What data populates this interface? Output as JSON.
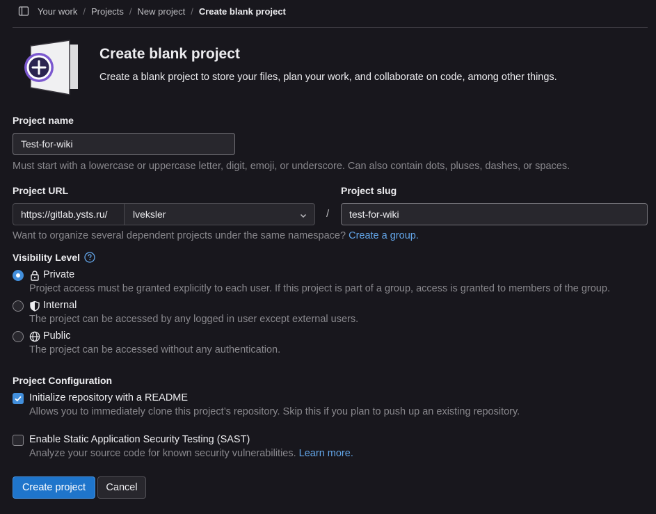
{
  "breadcrumb": {
    "items": [
      "Your work",
      "Projects",
      "New project"
    ],
    "current": "Create blank project",
    "separator": "/"
  },
  "header": {
    "title": "Create blank project",
    "description": "Create a blank project to store your files, plan your work, and collaborate on code, among other things."
  },
  "project_name": {
    "label": "Project name",
    "value": "Test-for-wiki",
    "help": "Must start with a lowercase or uppercase letter, digit, emoji, or underscore. Can also contain dots, pluses, dashes, or spaces."
  },
  "project_url": {
    "label": "Project URL",
    "prefix": "https://gitlab.ysts.ru/",
    "namespace": "lveksler",
    "separator": "/",
    "help": "Want to organize several dependent projects under the same namespace?",
    "help_link": "Create a group."
  },
  "project_slug": {
    "label": "Project slug",
    "value": "test-for-wiki"
  },
  "visibility": {
    "label": "Visibility Level",
    "options": [
      {
        "label": "Private",
        "icon": "lock-icon",
        "selected": true,
        "help": "Project access must be granted explicitly to each user. If this project is part of a group, access is granted to members of the group."
      },
      {
        "label": "Internal",
        "icon": "shield-icon",
        "selected": false,
        "help": "The project can be accessed by any logged in user except external users."
      },
      {
        "label": "Public",
        "icon": "earth-icon",
        "selected": false,
        "help": "The project can be accessed without any authentication."
      }
    ]
  },
  "configuration": {
    "label": "Project Configuration",
    "readme": {
      "label": "Initialize repository with a README",
      "checked": true,
      "help": "Allows you to immediately clone this project’s repository. Skip this if you plan to push up an existing repository."
    },
    "sast": {
      "label": "Enable Static Application Security Testing (SAST)",
      "checked": false,
      "help": "Analyze your source code for known security vulnerabilities.",
      "help_link": "Learn more."
    }
  },
  "actions": {
    "create": "Create project",
    "cancel": "Cancel"
  },
  "colors": {
    "background": "#18171d",
    "primary": "#1f75cb",
    "link": "#63a6e9",
    "illustration_accent": "#7b58cf"
  }
}
